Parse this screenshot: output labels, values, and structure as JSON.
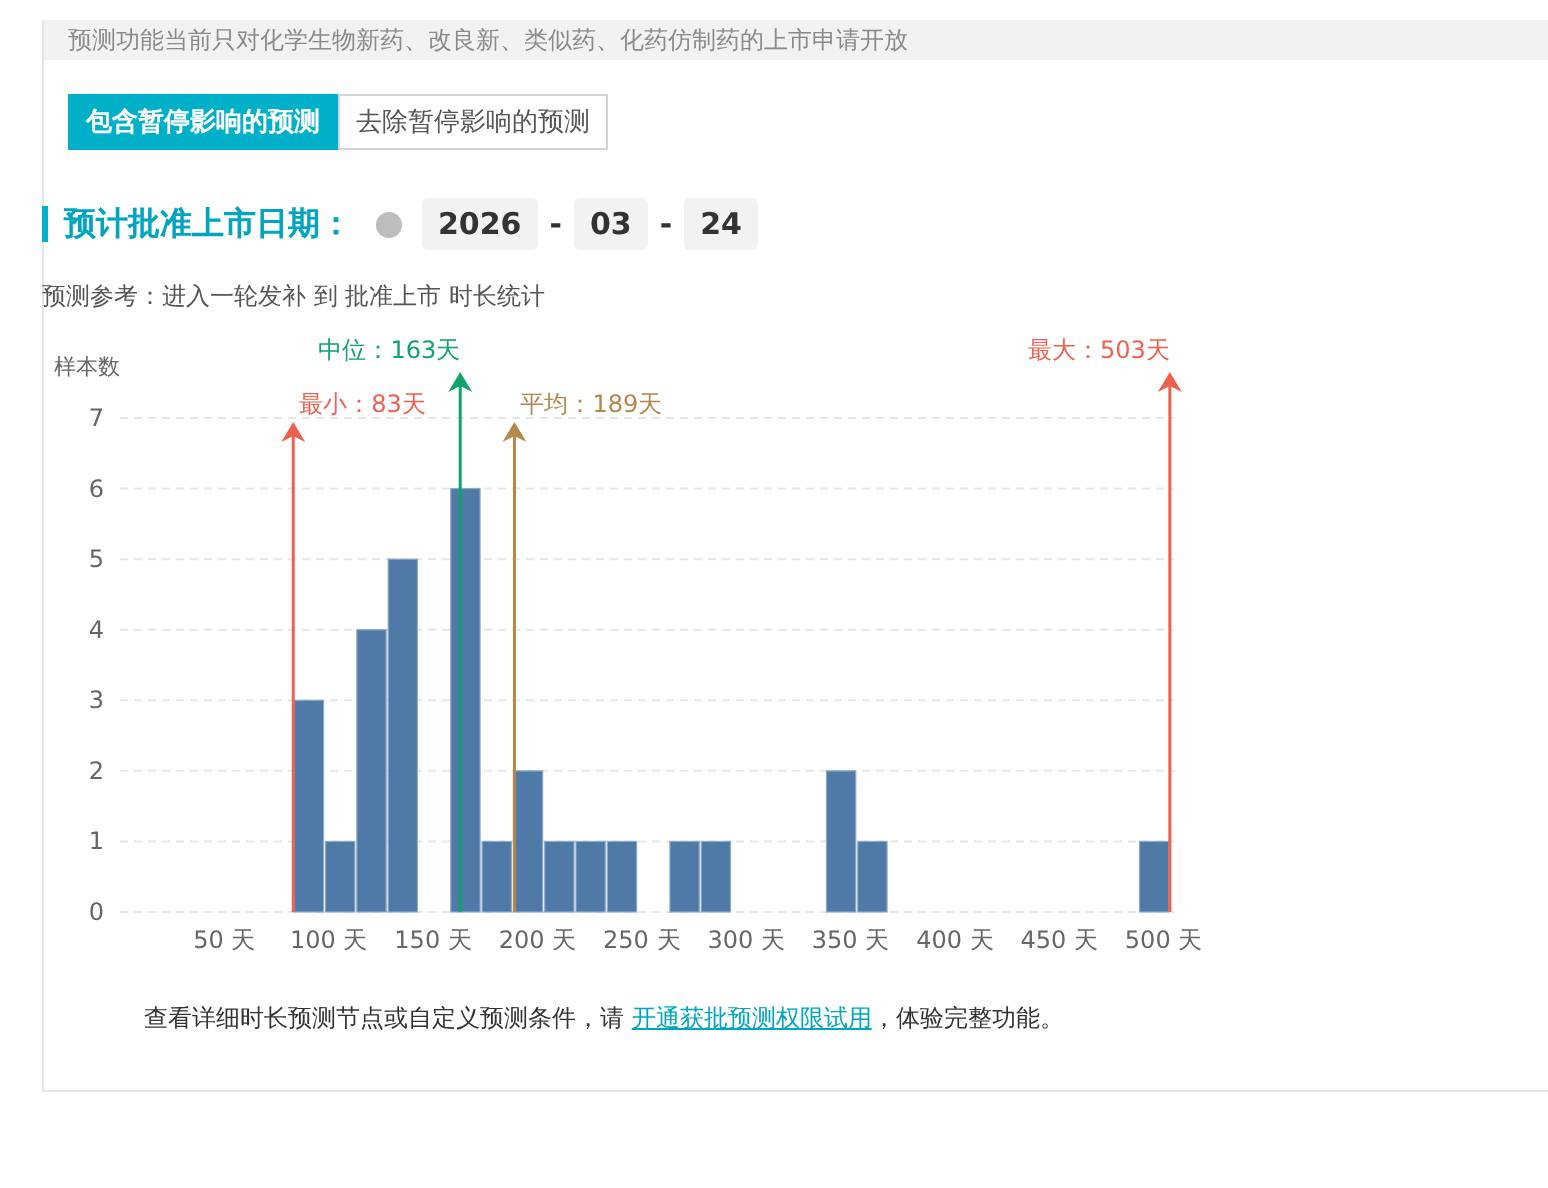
{
  "notice": "预测功能当前只对化学生物新药、改良新、类似药、化药仿制药的上市申请开放",
  "tabs": [
    {
      "label": "包含暂停影响的预测",
      "selected": true
    },
    {
      "label": "去除暂停影响的预测",
      "selected": false
    }
  ],
  "approval_date": {
    "label": "预计批准上市日期：",
    "segments": [
      {
        "kind": "value",
        "text": "2026"
      },
      {
        "kind": "separator",
        "text": "-"
      },
      {
        "kind": "value",
        "text": "03"
      },
      {
        "kind": "separator",
        "text": "-"
      },
      {
        "kind": "value",
        "text": "24"
      }
    ]
  },
  "reference": "预测参考：进入一轮发补 到 批准上市 时长统计",
  "chart": {
    "chart_data": {
      "type": "bar",
      "ylabel": "样本数",
      "grid": true,
      "x": [
        90.5,
        105.5,
        120.5,
        135.5,
        150.5,
        165.5,
        180.5,
        195.5,
        210.5,
        225.5,
        240.5,
        255.5,
        270.5,
        285.5,
        300.5,
        315.5,
        330.5,
        345.5,
        360.5,
        375.5,
        390.5,
        405.5,
        420.5,
        435.5,
        450.5,
        465.5,
        480.5,
        495.5
      ],
      "values": [
        3,
        1,
        4,
        5,
        0,
        6,
        1,
        2,
        1,
        1,
        1,
        0,
        1,
        1,
        0,
        0,
        0,
        2,
        1,
        0,
        0,
        0,
        0,
        0,
        0,
        0,
        0,
        1
      ],
      "xlim": [
        0,
        505
      ],
      "ylim": [
        0,
        7
      ],
      "xticks": [
        {
          "value": 50,
          "label": "50 天"
        },
        {
          "value": 100,
          "label": "100 天"
        },
        {
          "value": 150,
          "label": "150 天"
        },
        {
          "value": 200,
          "label": "200 天"
        },
        {
          "value": 250,
          "label": "250 天"
        },
        {
          "value": 300,
          "label": "300 天"
        },
        {
          "value": 350,
          "label": "350 天"
        },
        {
          "value": 400,
          "label": "400 天"
        },
        {
          "value": 450,
          "label": "450 天"
        },
        {
          "value": 500,
          "label": "500 天"
        }
      ],
      "yticks": [
        0,
        1,
        2,
        3,
        4,
        5,
        6,
        7
      ],
      "ref_lines": [
        {
          "axis": "x",
          "value": 83,
          "label": "最小：83天",
          "color": "#ee6150"
        },
        {
          "axis": "x",
          "value": 163,
          "label": "中位：163天",
          "color": "#10a36b"
        },
        {
          "axis": "x",
          "value": 189,
          "label": "平均：189天",
          "color": "#b5874a"
        },
        {
          "axis": "x",
          "value": 503,
          "label": "最大：503天",
          "color": "#ee6150"
        }
      ]
    }
  },
  "footer": {
    "before": "查看详细时长预测节点或自定义预测条件，请 ",
    "link": "开通获批预测权限试用",
    "after": "，体验完整功能。"
  }
}
